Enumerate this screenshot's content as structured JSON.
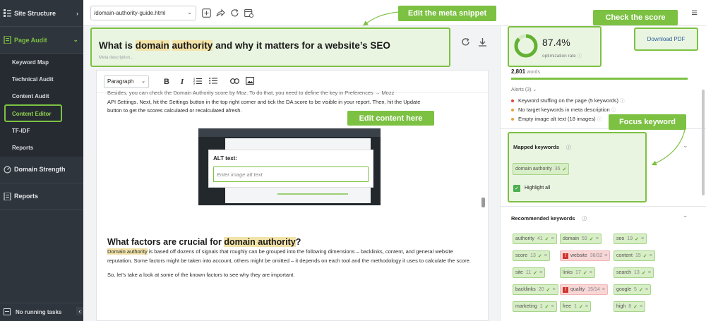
{
  "sidebar": {
    "sections": [
      {
        "label": "Site Structure",
        "icon": "site-structure-icon"
      },
      {
        "label": "Page Audit",
        "icon": "page-audit-icon"
      },
      {
        "label": "Domain Strength",
        "icon": "domain-strength-icon"
      },
      {
        "label": "Reports",
        "icon": "reports-icon"
      }
    ],
    "page_audit_items": [
      "Keyword Map",
      "Technical Audit",
      "Content Audit",
      "Content Editor",
      "TF-IDF",
      "Reports"
    ],
    "footer": "No running tasks"
  },
  "topbar": {
    "file": "/domain-authority-guide.html"
  },
  "editor": {
    "title_pre": "What is ",
    "title_kw1": "domain",
    "title_mid": " ",
    "title_kw2": "authority",
    "title_post": " and why it matters for a website’s SEO",
    "meta_placeholder": "Meta description...",
    "paragraph_select": "Paragraph",
    "body_lines": [
      "Besides, you can check the Domain Authority score by Moz. To do that, you need to define the key in Preferences → Mozz",
      "API Settings. Next, hit the Settings button in the top right corner and tick the DA score to be visible in your report. Then, hit the Update",
      "button to get the scores calculated or recalculated afresh."
    ],
    "alt_label": "ALT text:",
    "alt_placeholder": "Enter image alt text",
    "h2_pre": "What factors are crucial for ",
    "h2_kw": "domain authority",
    "h2_post": "?",
    "p2_kw": "Domain authority",
    "p2_rest": " is based off dozens of signals that roughly can be grouped into the following dimensions – backlinks, content, and general website reputation. Some factors might be taken into account, others might be omitted – it depends on each tool and the methodology it uses to calculate the score.",
    "p3": "So, let’s take a look at some of the known factors to see why they are important."
  },
  "right": {
    "score": "87.4%",
    "score_fraction": 0.874,
    "score_label": "optimization rate",
    "download": "Download PDF",
    "words_count": "2,801",
    "words_label": "words",
    "alerts_title": "Alerts (3)",
    "alerts": [
      {
        "text": "Keyword stuffing on the page (5 keywords)",
        "color": "#e0453a"
      },
      {
        "text": "No target keywords in meta description",
        "color": "#e8a23a"
      },
      {
        "text": "Empty image alt text (18 images)",
        "color": "#e8a23a"
      }
    ],
    "mapped_title": "Mapped keywords",
    "mapped_kw": {
      "kw": "domain authority",
      "n": "36"
    },
    "highlight_label": "Highlight all",
    "recommended_title": "Recommended keywords",
    "recommended": [
      [
        {
          "kw": "authority",
          "n": "41"
        },
        {
          "kw": "domain",
          "n": "59"
        },
        {
          "kw": "seo",
          "n": "19"
        }
      ],
      [
        {
          "kw": "score",
          "n": "13"
        },
        {
          "kw": "website",
          "n": "36/32",
          "red": true
        },
        {
          "kw": "content",
          "n": "15"
        }
      ],
      [
        {
          "kw": "site",
          "n": "11"
        },
        {
          "kw": "links",
          "n": "17"
        },
        {
          "kw": "search",
          "n": "13"
        }
      ],
      [
        {
          "kw": "backlinks",
          "n": "20"
        },
        {
          "kw": "quality",
          "n": "15/14",
          "red": true
        },
        {
          "kw": "google",
          "n": "5"
        }
      ],
      [
        {
          "kw": "marketing",
          "n": "1"
        },
        {
          "kw": "free",
          "n": "1"
        },
        {
          "kw": "high",
          "n": "8"
        }
      ]
    ]
  },
  "callouts": {
    "meta": "Edit the meta snippet",
    "score": "Check the score",
    "content": "Edit content here",
    "focus": "Focus keyword"
  },
  "colors": {
    "accent": "#7cc142",
    "sidebar": "#2f353c"
  }
}
